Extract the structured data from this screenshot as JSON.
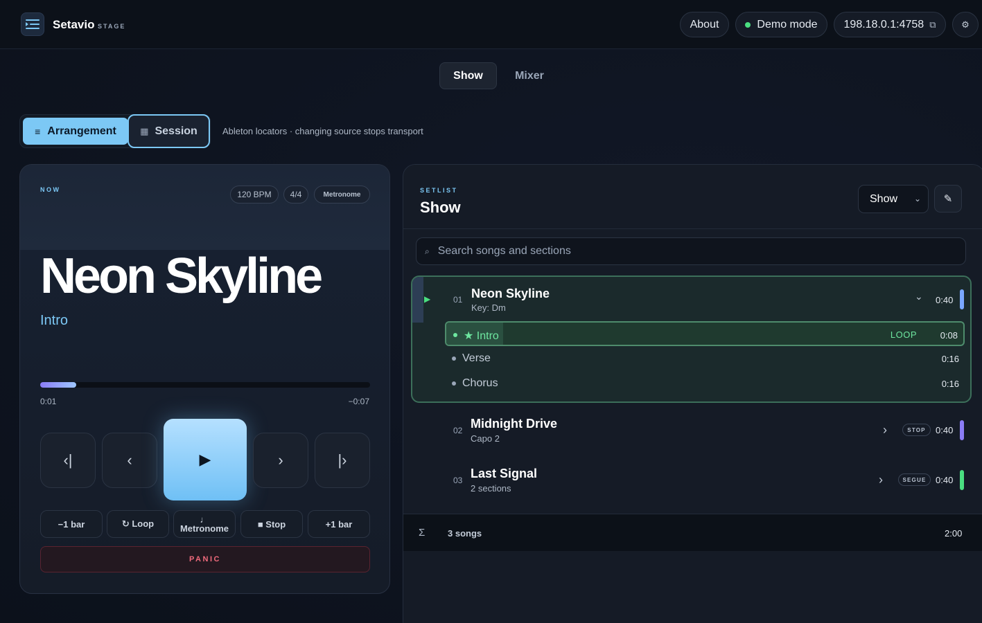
{
  "app": {
    "name": "Setavio",
    "sub": "STAGE"
  },
  "header": {
    "about_label": "About",
    "demo_label": "Demo mode",
    "address_label": "198.18.0.1:4758",
    "copy_glyph": "⧉",
    "settings_glyph": "⚙"
  },
  "tabs": [
    {
      "label": "Show"
    },
    {
      "label": "Mixer"
    }
  ],
  "mode": {
    "arrangement_label": "Arrangement",
    "session_label": "Session",
    "hint": "Ableton locators · changing source stops transport"
  },
  "now": {
    "label": "NOW",
    "bpm": "120 BPM",
    "signature": "4/4",
    "metronome_chip": "Metronome",
    "song_title": "Neon Skyline",
    "section": "Intro",
    "progress": 0.11,
    "elapsed": "0:01",
    "remaining": "−0:07",
    "transport": {
      "prev_song_glyph": "‹|",
      "prev_section_glyph": "‹",
      "play_glyph": "▶",
      "next_section_glyph": "›",
      "next_song_glyph": "|›"
    },
    "secondary": {
      "minus_bar": "−1 bar",
      "loop": "↻ Loop",
      "metronome_glyph": "♩",
      "metronome": "Metronome",
      "stop": "■ Stop",
      "plus_bar": "+1 bar"
    },
    "panic_label": "PANIC"
  },
  "setlist": {
    "label": "SETLIST",
    "title": "Show",
    "select_value": "Show",
    "edit_glyph": "✎",
    "search_placeholder": "Search songs and sections",
    "songs": [
      {
        "num": "01",
        "name": "Neon Skyline",
        "meta": "Key: Dm",
        "duration": "0:40",
        "color": "#7aa7ff",
        "sections": [
          {
            "name": "★ Intro",
            "badge": "LOOP",
            "duration": "0:08"
          },
          {
            "name": "Verse",
            "duration": "0:16"
          },
          {
            "name": "Chorus",
            "duration": "0:16"
          }
        ]
      },
      {
        "num": "02",
        "name": "Midnight Drive",
        "meta": "Capo 2",
        "badge": "STOP",
        "duration": "0:40",
        "color": "#8b7cf5"
      },
      {
        "num": "03",
        "name": "Last Signal",
        "meta": "2 sections",
        "badge": "SEGUE",
        "duration": "0:40",
        "color": "#4ade80"
      }
    ],
    "footer": {
      "sigma": "Σ",
      "count": "3 songs",
      "total": "2:00"
    }
  },
  "colors": {
    "accent": "#7cc8f5",
    "success": "#6ee7a0",
    "danger": "#ef6a7c"
  }
}
